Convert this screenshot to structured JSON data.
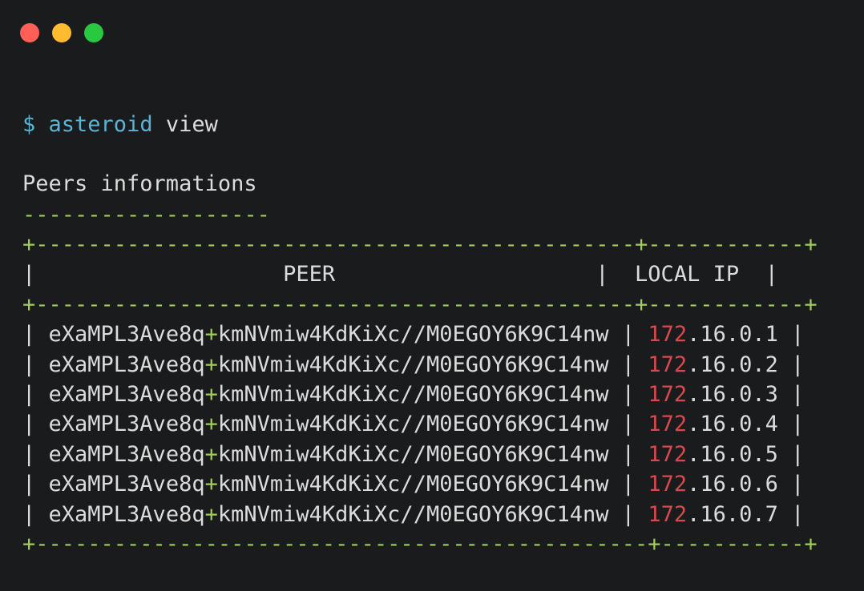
{
  "window": {
    "controls": [
      {
        "name": "close",
        "color": "#ff5f57"
      },
      {
        "name": "minimize",
        "color": "#febc2e"
      },
      {
        "name": "maximize",
        "color": "#28c840"
      }
    ]
  },
  "command": {
    "prompt": "$",
    "program": "asteroid",
    "argument": "view"
  },
  "section": {
    "title": "Peers informations",
    "underline": "-------------------"
  },
  "table": {
    "border_top": "+----------------------------------------------+------------+",
    "border_header": "+----------------------------------------------+------------+",
    "border_bottom": "+-----------------------------------------------+-----------+",
    "headers": {
      "peer": "PEER",
      "local_ip": "LOCAL IP"
    },
    "rows": [
      {
        "peer_a": "eXaMPL3Ave8q",
        "peer_sep": "+",
        "peer_b": "kmNVmiw4KdKiXc//M0EGOY6K9C14nw",
        "ip_first": "172",
        "ip_rest": ".16.0.1"
      },
      {
        "peer_a": "eXaMPL3Ave8q",
        "peer_sep": "+",
        "peer_b": "kmNVmiw4KdKiXc//M0EGOY6K9C14nw",
        "ip_first": "172",
        "ip_rest": ".16.0.2"
      },
      {
        "peer_a": "eXaMPL3Ave8q",
        "peer_sep": "+",
        "peer_b": "kmNVmiw4KdKiXc//M0EGOY6K9C14nw",
        "ip_first": "172",
        "ip_rest": ".16.0.3"
      },
      {
        "peer_a": "eXaMPL3Ave8q",
        "peer_sep": "+",
        "peer_b": "kmNVmiw4KdKiXc//M0EGOY6K9C14nw",
        "ip_first": "172",
        "ip_rest": ".16.0.4"
      },
      {
        "peer_a": "eXaMPL3Ave8q",
        "peer_sep": "+",
        "peer_b": "kmNVmiw4KdKiXc//M0EGOY6K9C14nw",
        "ip_first": "172",
        "ip_rest": ".16.0.5"
      },
      {
        "peer_a": "eXaMPL3Ave8q",
        "peer_sep": "+",
        "peer_b": "kmNVmiw4KdKiXc//M0EGOY6K9C14nw",
        "ip_first": "172",
        "ip_rest": ".16.0.6"
      },
      {
        "peer_a": "eXaMPL3Ave8q",
        "peer_sep": "+",
        "peer_b": "kmNVmiw4KdKiXc//M0EGOY6K9C14nw",
        "ip_first": "172",
        "ip_rest": ".16.0.7"
      }
    ]
  },
  "colors": {
    "background": "#1a1b1d",
    "text": "#dcdcdc",
    "prompt": "#5ab4d6",
    "border": "#a2cc5c",
    "ip_highlight": "#d8494f"
  }
}
